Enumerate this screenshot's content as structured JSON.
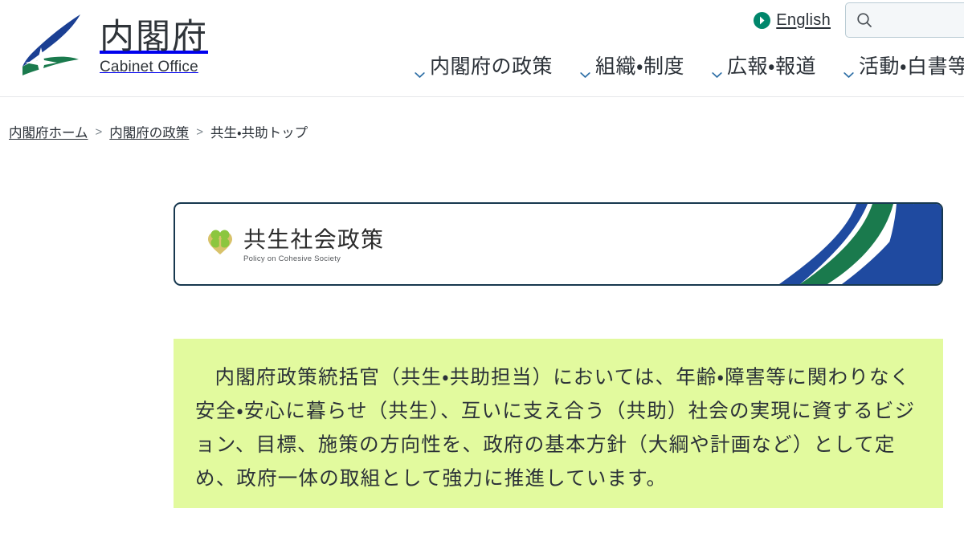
{
  "header": {
    "brand": {
      "name_ja": "内閣府",
      "name_en": "Cabinet Office",
      "logo_icon": "cabinet-office-logo-icon",
      "logo_colors": {
        "blue": "#1b3f93",
        "green": "#1a7a4d"
      }
    },
    "utility": {
      "language_link": {
        "label": "English",
        "icon": "circle-arrow-right-icon",
        "icon_color": "#00866b"
      },
      "search": {
        "icon": "search-icon",
        "value": "",
        "placeholder": ""
      }
    },
    "nav": {
      "items": [
        {
          "label": "内閣府の政策",
          "icon": "chevron-down-icon"
        },
        {
          "label": "組織・制度",
          "icon": "chevron-down-icon"
        },
        {
          "label": "広報・報道",
          "icon": "chevron-down-icon"
        },
        {
          "label": "活動・白書等",
          "icon": "chevron-down-icon"
        }
      ]
    }
  },
  "breadcrumb": {
    "items": [
      {
        "label": "内閣府ホーム",
        "is_link": true
      },
      {
        "label": "内閣府の政策",
        "is_link": true
      },
      {
        "label": "共生・共助トップ",
        "is_link": false
      }
    ],
    "separator": ">"
  },
  "banner": {
    "title_ja": "共生社会政策",
    "title_en": "Policy on Cohesive Society",
    "mark_icon": "clover-heart-icon",
    "mark_colors": {
      "clover": "#8cc63f",
      "heart": "#d8c26a"
    },
    "border_color": "#17384f",
    "decoration_icon": "ribbon-swoosh-graphic",
    "decoration_colors": {
      "blue": "#1f4aa0",
      "green": "#1a7a4d"
    }
  },
  "lead": {
    "background_color": "#e2fa9e",
    "text": "内閣府政策統括官（共生・共助担当）においては、年齢・障害等に関わりなく安全・安心に暮らせ（共生）、互いに支え合う（共助）社会の実現に資するビジョン、目標、施策の方向性を、政府の基本方針（大綱や計画など）として定め、政府一体の取組として強力に推進しています。"
  }
}
